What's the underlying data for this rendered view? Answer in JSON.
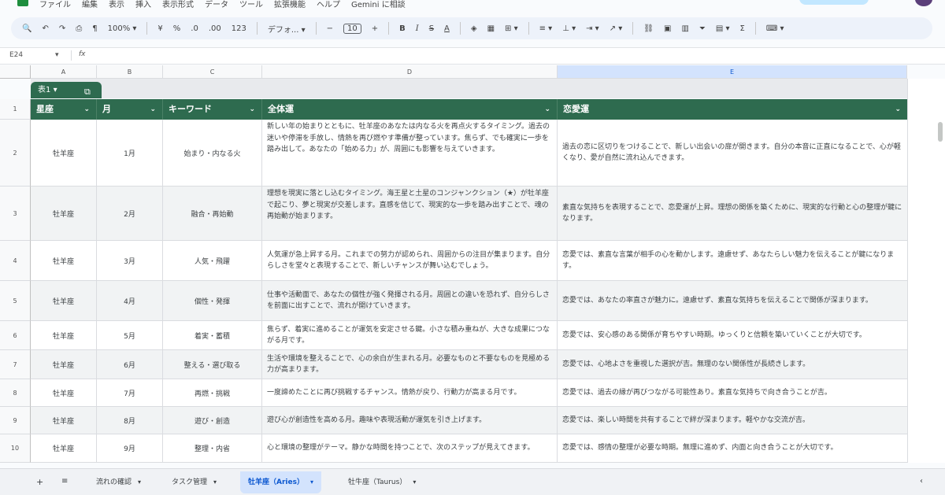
{
  "menu": [
    "ファイル",
    "編集",
    "表示",
    "挿入",
    "表示形式",
    "データ",
    "ツール",
    "拡張機能",
    "ヘルプ",
    "Gemini に相談"
  ],
  "toolbar": {
    "zoom": "100%",
    "percent": "%",
    "font": "デフォ...",
    "font_size": "10",
    "currency": ".0",
    "decimal": ".00",
    "number_format": "123",
    "minus": "−",
    "plus": "+"
  },
  "formula_bar": {
    "cell_ref": "E24",
    "fx": "fx",
    "value": ""
  },
  "column_letters": [
    "A",
    "B",
    "C",
    "D",
    "E"
  ],
  "table": {
    "name": "表1",
    "headers": [
      "星座",
      "月",
      "キーワード",
      "全体運",
      "恋愛運"
    ],
    "rows": [
      {
        "num": "2",
        "sign": "牡羊座",
        "month": "1月",
        "keyword": "始まり・内なる火",
        "overall": "新しい年の始まりとともに、牡羊座のあなたは内なる火を再点火するタイミング。過去の迷いや停滞を手放し、情熱を再び燃やす準備が整っています。焦らず、でも確実に一歩を踏み出して。あなたの「始める力」が、周囲にも影響を与えていきます。",
        "love": "過去の恋に区切りをつけることで、新しい出会いの扉が開きます。自分の本音に正直になることで、心が軽くなり、愛が自然に流れ込んできます。"
      },
      {
        "num": "3",
        "sign": "牡羊座",
        "month": "2月",
        "keyword": "融合・再始動",
        "overall": "理想を現実に落とし込むタイミング。海王星と土星のコンジャンクション（★）が牡羊座で起こり、夢と現実が交差します。直感を信じて、現実的な一歩を踏み出すことで、魂の再始動が始まります。",
        "love": "素直な気持ちを表現することで、恋愛運が上昇。理想の関係を築くために、現実的な行動と心の整理が鍵になります。"
      },
      {
        "num": "4",
        "sign": "牡羊座",
        "month": "3月",
        "keyword": "人気・飛躍",
        "overall": "人気運が急上昇する月。これまでの努力が認められ、周囲からの注目が集まります。自分らしさを堂々と表現することで、新しいチャンスが舞い込むでしょう。",
        "love": "恋愛では、素直な言葉が相手の心を動かします。遠慮せず、あなたらしい魅力を伝えることが鍵になります。"
      },
      {
        "num": "5",
        "sign": "牡羊座",
        "month": "4月",
        "keyword": "個性・発揮",
        "overall": "仕事や活動面で、あなたの個性が強く発揮される月。周囲との違いを恐れず、自分らしさを前面に出すことで、流れが開けていきます。",
        "love": "恋愛では、あなたの率直さが魅力に。遠慮せず、素直な気持ちを伝えることで関係が深まります。"
      },
      {
        "num": "6",
        "sign": "牡羊座",
        "month": "5月",
        "keyword": "着実・蓄積",
        "overall": "焦らず、着実に進めることが運気を安定させる鍵。小さな積み重ねが、大きな成果につながる月です。",
        "love": "恋愛では、安心感のある関係が育ちやすい時期。ゆっくりと信頼を築いていくことが大切です。"
      },
      {
        "num": "7",
        "sign": "牡羊座",
        "month": "6月",
        "keyword": "整える・選び取る",
        "overall": "生活や環境を整えることで、心の余白が生まれる月。必要なものと不要なものを見極める力が高まります。",
        "love": "恋愛では、心地よさを重視した選択が吉。無理のない関係性が長続きします。"
      },
      {
        "num": "8",
        "sign": "牡羊座",
        "month": "7月",
        "keyword": "再燃・挑戦",
        "overall": "一度諦めたことに再び挑戦するチャンス。情熱が戻り、行動力が高まる月です。",
        "love": "恋愛では、過去の縁が再びつながる可能性あり。素直な気持ちで向き合うことが吉。"
      },
      {
        "num": "9",
        "sign": "牡羊座",
        "month": "8月",
        "keyword": "遊び・創造",
        "overall": "遊び心が創造性を高める月。趣味や表現活動が運気を引き上げます。",
        "love": "恋愛では、楽しい時間を共有することで絆が深まります。軽やかな交流が吉。"
      },
      {
        "num": "10",
        "sign": "牡羊座",
        "month": "9月",
        "keyword": "整理・内省",
        "overall": "心と環境の整理がテーマ。静かな時間を持つことで、次のステップが見えてきます。",
        "love": "恋愛では、感情の整理が必要な時期。無理に進めず、内面と向き合うことが大切です。"
      }
    ]
  },
  "sheet_tabs": [
    "流れの確認",
    "タスク管理",
    "牡羊座（Aries）",
    "牡牛座（Taurus）"
  ],
  "active_sheet": "牡羊座（Aries）"
}
